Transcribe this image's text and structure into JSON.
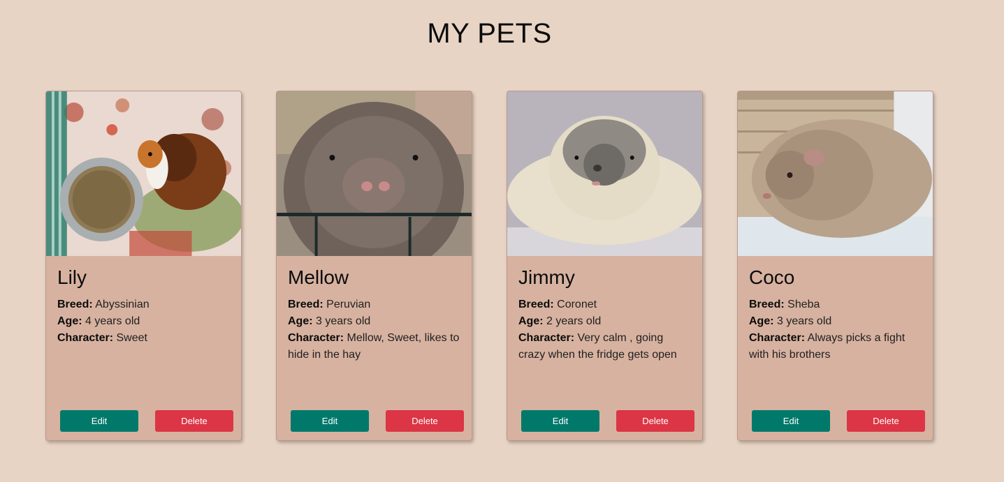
{
  "page": {
    "title": "MY PETS"
  },
  "labels": {
    "breed": "Breed:",
    "age": "Age:",
    "character": "Character:"
  },
  "colors": {
    "background": "#e8d4c5",
    "card": "#d7b2a0",
    "edit_button": "#00796b",
    "delete_button": "#dc3545"
  },
  "pets": [
    {
      "name": "Lily",
      "breed": "Abyssinian",
      "age": "4 years old",
      "character": "Sweet",
      "edit_label": "Edit",
      "delete_label": "Delete"
    },
    {
      "name": "Mellow",
      "breed": "Peruvian",
      "age": "3 years old",
      "character": "Mellow, Sweet, likes to hide in the hay",
      "edit_label": "Edit",
      "delete_label": "Delete"
    },
    {
      "name": "Jimmy",
      "breed": "Coronet",
      "age": "2 years old",
      "character": "Very calm , going crazy when the fridge gets open",
      "edit_label": "Edit",
      "delete_label": "Delete"
    },
    {
      "name": "Coco",
      "breed": "Sheba",
      "age": "3 years old",
      "character": "Always picks a fight with his brothers",
      "edit_label": "Edit",
      "delete_label": "Delete"
    }
  ]
}
